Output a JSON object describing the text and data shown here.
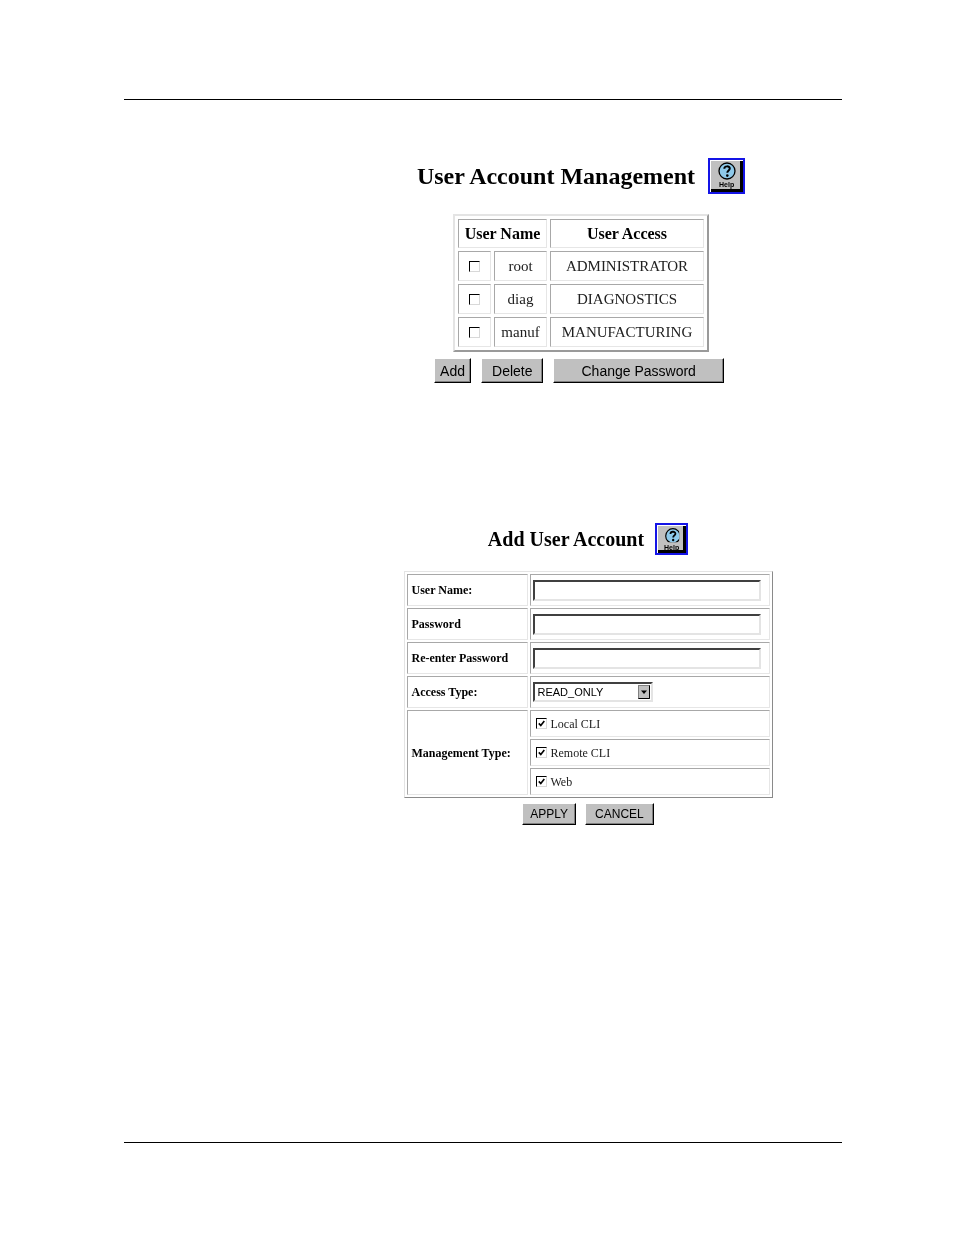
{
  "user_account_management": {
    "title": "User Account Management",
    "help_label": "Help",
    "table": {
      "columns": [
        {
          "label": "User Name"
        },
        {
          "label": "User Access"
        }
      ],
      "rows": [
        {
          "checked": false,
          "user_name": "root",
          "user_access": "ADMINISTRATOR"
        },
        {
          "checked": false,
          "user_name": "diag",
          "user_access": "DIAGNOSTICS"
        },
        {
          "checked": false,
          "user_name": "manuf",
          "user_access": "MANUFACTURING"
        }
      ]
    },
    "buttons": [
      {
        "label": "Add"
      },
      {
        "label": "Delete"
      },
      {
        "label": "Change Password"
      }
    ]
  },
  "add_user_account": {
    "title": "Add User Account",
    "help_label": "Help",
    "fields": [
      {
        "kind": "text",
        "label": "User Name:"
      },
      {
        "kind": "text",
        "label": "Password"
      },
      {
        "kind": "text",
        "label": "Re-enter Password"
      },
      {
        "kind": "select",
        "label": "Access Type:",
        "value": "READ_ONLY"
      },
      {
        "kind": "checkboxes",
        "label": "Management Type:",
        "options": [
          {
            "label": "Local CLI",
            "checked": true
          },
          {
            "label": "Remote CLI",
            "checked": true
          },
          {
            "label": "Web",
            "checked": true
          }
        ]
      }
    ],
    "buttons": [
      {
        "label": "APPLY"
      },
      {
        "label": "CANCEL"
      }
    ]
  }
}
